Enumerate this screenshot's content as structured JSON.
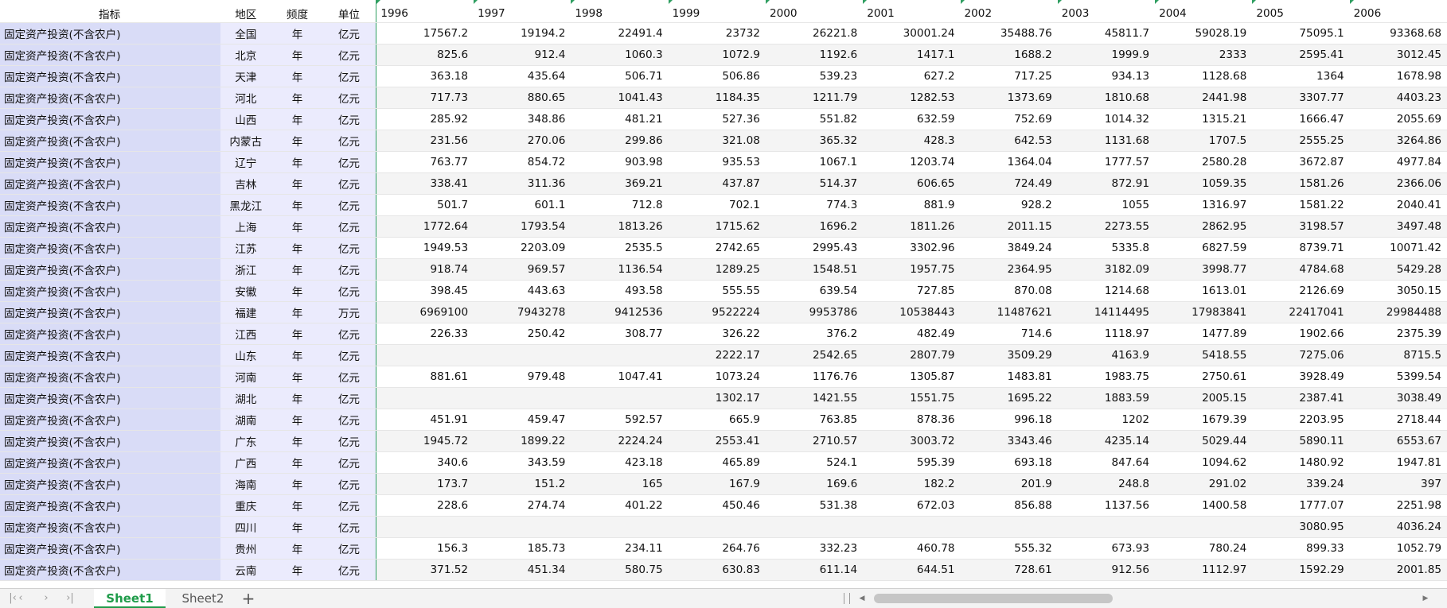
{
  "sheet": {
    "headers": {
      "indicator": "指标",
      "region": "地区",
      "frequency": "频度",
      "unit": "单位",
      "years": [
        "1996",
        "1997",
        "1998",
        "1999",
        "2000",
        "2001",
        "2002",
        "2003",
        "2004",
        "2005",
        "2006"
      ]
    },
    "rows": [
      {
        "indicator": "固定资产投资(不含农户)",
        "region": "全国",
        "frequency": "年",
        "unit": "亿元",
        "values": [
          "17567.2",
          "19194.2",
          "22491.4",
          "23732",
          "26221.8",
          "30001.24",
          "35488.76",
          "45811.7",
          "59028.19",
          "75095.1",
          "93368.68"
        ]
      },
      {
        "indicator": "固定资产投资(不含农户)",
        "region": "北京",
        "frequency": "年",
        "unit": "亿元",
        "values": [
          "825.6",
          "912.4",
          "1060.3",
          "1072.9",
          "1192.6",
          "1417.1",
          "1688.2",
          "1999.9",
          "2333",
          "2595.41",
          "3012.45"
        ]
      },
      {
        "indicator": "固定资产投资(不含农户)",
        "region": "天津",
        "frequency": "年",
        "unit": "亿元",
        "values": [
          "363.18",
          "435.64",
          "506.71",
          "506.86",
          "539.23",
          "627.2",
          "717.25",
          "934.13",
          "1128.68",
          "1364",
          "1678.98"
        ]
      },
      {
        "indicator": "固定资产投资(不含农户)",
        "region": "河北",
        "frequency": "年",
        "unit": "亿元",
        "values": [
          "717.73",
          "880.65",
          "1041.43",
          "1184.35",
          "1211.79",
          "1282.53",
          "1373.69",
          "1810.68",
          "2441.98",
          "3307.77",
          "4403.23"
        ]
      },
      {
        "indicator": "固定资产投资(不含农户)",
        "region": "山西",
        "frequency": "年",
        "unit": "亿元",
        "values": [
          "285.92",
          "348.86",
          "481.21",
          "527.36",
          "551.82",
          "632.59",
          "752.69",
          "1014.32",
          "1315.21",
          "1666.47",
          "2055.69"
        ]
      },
      {
        "indicator": "固定资产投资(不含农户)",
        "region": "内蒙古",
        "frequency": "年",
        "unit": "亿元",
        "values": [
          "231.56",
          "270.06",
          "299.86",
          "321.08",
          "365.32",
          "428.3",
          "642.53",
          "1131.68",
          "1707.5",
          "2555.25",
          "3264.86"
        ]
      },
      {
        "indicator": "固定资产投资(不含农户)",
        "region": "辽宁",
        "frequency": "年",
        "unit": "亿元",
        "values": [
          "763.77",
          "854.72",
          "903.98",
          "935.53",
          "1067.1",
          "1203.74",
          "1364.04",
          "1777.57",
          "2580.28",
          "3672.87",
          "4977.84"
        ]
      },
      {
        "indicator": "固定资产投资(不含农户)",
        "region": "吉林",
        "frequency": "年",
        "unit": "亿元",
        "values": [
          "338.41",
          "311.36",
          "369.21",
          "437.87",
          "514.37",
          "606.65",
          "724.49",
          "872.91",
          "1059.35",
          "1581.26",
          "2366.06"
        ]
      },
      {
        "indicator": "固定资产投资(不含农户)",
        "region": "黑龙江",
        "frequency": "年",
        "unit": "亿元",
        "values": [
          "501.7",
          "601.1",
          "712.8",
          "702.1",
          "774.3",
          "881.9",
          "928.2",
          "1055",
          "1316.97",
          "1581.22",
          "2040.41"
        ]
      },
      {
        "indicator": "固定资产投资(不含农户)",
        "region": "上海",
        "frequency": "年",
        "unit": "亿元",
        "values": [
          "1772.64",
          "1793.54",
          "1813.26",
          "1715.62",
          "1696.2",
          "1811.26",
          "2011.15",
          "2273.55",
          "2862.95",
          "3198.57",
          "3497.48"
        ]
      },
      {
        "indicator": "固定资产投资(不含农户)",
        "region": "江苏",
        "frequency": "年",
        "unit": "亿元",
        "values": [
          "1949.53",
          "2203.09",
          "2535.5",
          "2742.65",
          "2995.43",
          "3302.96",
          "3849.24",
          "5335.8",
          "6827.59",
          "8739.71",
          "10071.42"
        ]
      },
      {
        "indicator": "固定资产投资(不含农户)",
        "region": "浙江",
        "frequency": "年",
        "unit": "亿元",
        "values": [
          "918.74",
          "969.57",
          "1136.54",
          "1289.25",
          "1548.51",
          "1957.75",
          "2364.95",
          "3182.09",
          "3998.77",
          "4784.68",
          "5429.28"
        ]
      },
      {
        "indicator": "固定资产投资(不含农户)",
        "region": "安徽",
        "frequency": "年",
        "unit": "亿元",
        "values": [
          "398.45",
          "443.63",
          "493.58",
          "555.55",
          "639.54",
          "727.85",
          "870.08",
          "1214.68",
          "1613.01",
          "2126.69",
          "3050.15"
        ]
      },
      {
        "indicator": "固定资产投资(不含农户)",
        "region": "福建",
        "frequency": "年",
        "unit": "万元",
        "values": [
          "6969100",
          "7943278",
          "9412536",
          "9522224",
          "9953786",
          "10538443",
          "11487621",
          "14114495",
          "17983841",
          "22417041",
          "29984488"
        ]
      },
      {
        "indicator": "固定资产投资(不含农户)",
        "region": "江西",
        "frequency": "年",
        "unit": "亿元",
        "values": [
          "226.33",
          "250.42",
          "308.77",
          "326.22",
          "376.2",
          "482.49",
          "714.6",
          "1118.97",
          "1477.89",
          "1902.66",
          "2375.39"
        ]
      },
      {
        "indicator": "固定资产投资(不含农户)",
        "region": "山东",
        "frequency": "年",
        "unit": "亿元",
        "values": [
          "",
          "",
          "",
          "2222.17",
          "2542.65",
          "2807.79",
          "3509.29",
          "4163.9",
          "5418.55",
          "7275.06",
          "8715.5"
        ]
      },
      {
        "indicator": "固定资产投资(不含农户)",
        "region": "河南",
        "frequency": "年",
        "unit": "亿元",
        "values": [
          "881.61",
          "979.48",
          "1047.41",
          "1073.24",
          "1176.76",
          "1305.87",
          "1483.81",
          "1983.75",
          "2750.61",
          "3928.49",
          "5399.54"
        ]
      },
      {
        "indicator": "固定资产投资(不含农户)",
        "region": "湖北",
        "frequency": "年",
        "unit": "亿元",
        "values": [
          "",
          "",
          "",
          "1302.17",
          "1421.55",
          "1551.75",
          "1695.22",
          "1883.59",
          "2005.15",
          "2387.41",
          "3038.49"
        ]
      },
      {
        "indicator": "固定资产投资(不含农户)",
        "region": "湖南",
        "frequency": "年",
        "unit": "亿元",
        "values": [
          "451.91",
          "459.47",
          "592.57",
          "665.9",
          "763.85",
          "878.36",
          "996.18",
          "1202",
          "1679.39",
          "2203.95",
          "2718.44"
        ]
      },
      {
        "indicator": "固定资产投资(不含农户)",
        "region": "广东",
        "frequency": "年",
        "unit": "亿元",
        "values": [
          "1945.72",
          "1899.22",
          "2224.24",
          "2553.41",
          "2710.57",
          "3003.72",
          "3343.46",
          "4235.14",
          "5029.44",
          "5890.11",
          "6553.67"
        ]
      },
      {
        "indicator": "固定资产投资(不含农户)",
        "region": "广西",
        "frequency": "年",
        "unit": "亿元",
        "values": [
          "340.6",
          "343.59",
          "423.18",
          "465.89",
          "524.1",
          "595.39",
          "693.18",
          "847.64",
          "1094.62",
          "1480.92",
          "1947.81"
        ]
      },
      {
        "indicator": "固定资产投资(不含农户)",
        "region": "海南",
        "frequency": "年",
        "unit": "亿元",
        "values": [
          "173.7",
          "151.2",
          "165",
          "167.9",
          "169.6",
          "182.2",
          "201.9",
          "248.8",
          "291.02",
          "339.24",
          "397"
        ]
      },
      {
        "indicator": "固定资产投资(不含农户)",
        "region": "重庆",
        "frequency": "年",
        "unit": "亿元",
        "values": [
          "228.6",
          "274.74",
          "401.22",
          "450.46",
          "531.38",
          "672.03",
          "856.88",
          "1137.56",
          "1400.58",
          "1777.07",
          "2251.98"
        ]
      },
      {
        "indicator": "固定资产投资(不含农户)",
        "region": "四川",
        "frequency": "年",
        "unit": "亿元",
        "values": [
          "",
          "",
          "",
          "",
          "",
          "",
          "",
          "",
          "",
          "3080.95",
          "4036.24"
        ]
      },
      {
        "indicator": "固定资产投资(不含农户)",
        "region": "贵州",
        "frequency": "年",
        "unit": "亿元",
        "values": [
          "156.3",
          "185.73",
          "234.11",
          "264.76",
          "332.23",
          "460.78",
          "555.32",
          "673.93",
          "780.24",
          "899.33",
          "1052.79"
        ]
      },
      {
        "indicator": "固定资产投资(不含农户)",
        "region": "云南",
        "frequency": "年",
        "unit": "亿元",
        "values": [
          "371.52",
          "451.34",
          "580.75",
          "630.83",
          "611.14",
          "644.51",
          "728.61",
          "912.56",
          "1112.97",
          "1592.29",
          "2001.85"
        ]
      }
    ]
  },
  "tabs": {
    "items": [
      {
        "label": "Sheet1",
        "active": true
      },
      {
        "label": "Sheet2",
        "active": false
      }
    ],
    "add_label": "+"
  },
  "icons": {
    "first": "first-sheet-icon",
    "prev": "prev-sheet-icon",
    "next": "next-sheet-icon",
    "last": "last-sheet-icon"
  },
  "colors": {
    "accent": "#1f9c4a",
    "indicator_bg": "#d9dcf7",
    "meta_bg": "#ebebfd"
  }
}
